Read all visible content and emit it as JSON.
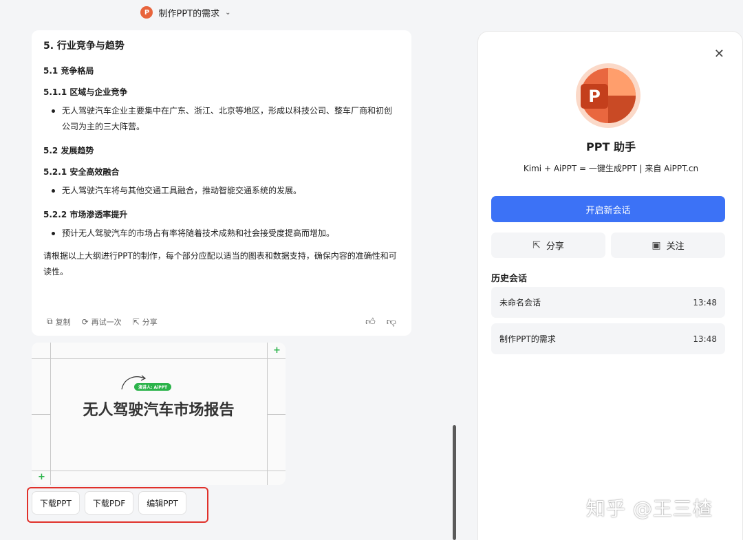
{
  "topbar": {
    "title": "制作PPT的需求",
    "app_icon": "P"
  },
  "message": {
    "h_5": "5. 行业竞争与趋势",
    "h_5_1": "5.1 竞争格局",
    "h_5_1_1": "5.1.1 区域与企业竞争",
    "b_5_1_1": "无人驾驶汽车企业主要集中在广东、浙江、北京等地区，形成以科技公司、整车厂商和初创公司为主的三大阵营。",
    "h_5_2": "5.2 发展趋势",
    "h_5_2_1": "5.2.1 安全高效融合",
    "b_5_2_1": "无人驾驶汽车将与其他交通工具融合，推动智能交通系统的发展。",
    "h_5_2_2": "5.2.2 市场渗透率提升",
    "b_5_2_2": "预计无人驾驶汽车的市场占有率将随着技术成熟和社会接受度提高而增加。",
    "closing": "请根据以上大纲进行PPT的制作，每个部分应配以适当的图表和数据支持，确保内容的准确性和可读性。",
    "actions": {
      "copy": "复制",
      "retry": "再试一次",
      "share": "分享"
    }
  },
  "slide": {
    "tag": "演讲人: AiPPT",
    "title": "无人驾驶汽车市场报告"
  },
  "downloads": {
    "ppt": "下载PPT",
    "pdf": "下载PDF",
    "edit": "编辑PPT"
  },
  "panel": {
    "logo_letter": "P",
    "name": "PPT 助手",
    "desc": "Kimi + AiPPT = 一键生成PPT | 来自 AiPPT.cn",
    "new_chat": "开启新会话",
    "share": "分享",
    "follow": "关注",
    "history_label": "历史会话",
    "history": [
      {
        "title": "未命名会话",
        "time": "13:48"
      },
      {
        "title": "制作PPT的需求",
        "time": "13:48"
      }
    ]
  },
  "watermark": "知乎 @王三楂",
  "colors": {
    "primary": "#3c72f6",
    "accent_red": "#e0302a",
    "ppt_orange": "#e9673f",
    "slide_green": "#2bb34a"
  }
}
